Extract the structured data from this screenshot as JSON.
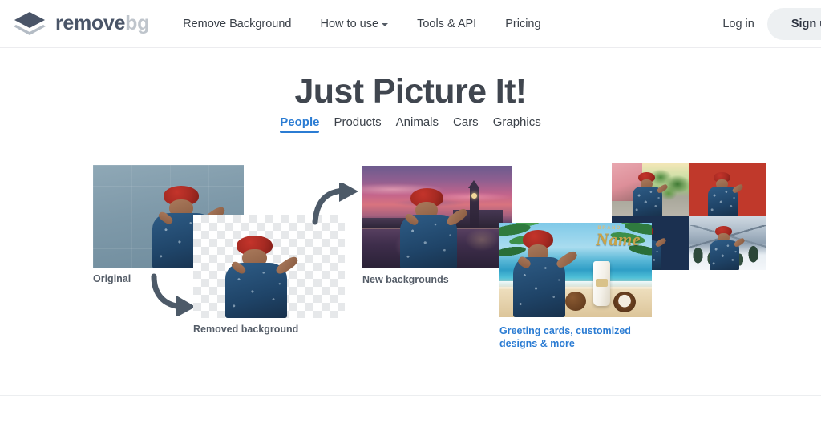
{
  "header": {
    "logo": {
      "icon": "layers-diamond-icon",
      "primary": "remove",
      "secondary": "bg"
    },
    "nav": [
      {
        "label": "Remove Background",
        "has_dropdown": false
      },
      {
        "label": "How to use",
        "has_dropdown": true
      },
      {
        "label": "Tools & API",
        "has_dropdown": false
      },
      {
        "label": "Pricing",
        "has_dropdown": false
      }
    ],
    "login_label": "Log in",
    "signup_label": "Sign up"
  },
  "hero": {
    "title": "Just Picture It!",
    "tabs": [
      {
        "label": "People",
        "active": true
      },
      {
        "label": "Products",
        "active": false
      },
      {
        "label": "Animals",
        "active": false
      },
      {
        "label": "Cars",
        "active": false
      },
      {
        "label": "Graphics",
        "active": false
      }
    ]
  },
  "showcase": {
    "original_caption": "Original",
    "removed_caption": "Removed background",
    "new_backgrounds_caption": "New backgrounds",
    "greeting_caption": "Greeting cards, customized designs & more",
    "card_text": {
      "brand": "BRAND",
      "name": "Name"
    },
    "arrow_down_icon": "curved-arrow-down-right-icon",
    "arrow_up_icon": "curved-arrow-up-right-icon"
  },
  "colors": {
    "accent_blue": "#2b7cd3",
    "heading": "#40464f",
    "logo_primary": "#4a5568",
    "logo_secondary": "#bfc5cc",
    "signup_bg": "#edf0f2",
    "panel_red": "#c0392b",
    "panel_navy": "#1b3050",
    "caption": "#555d68"
  }
}
